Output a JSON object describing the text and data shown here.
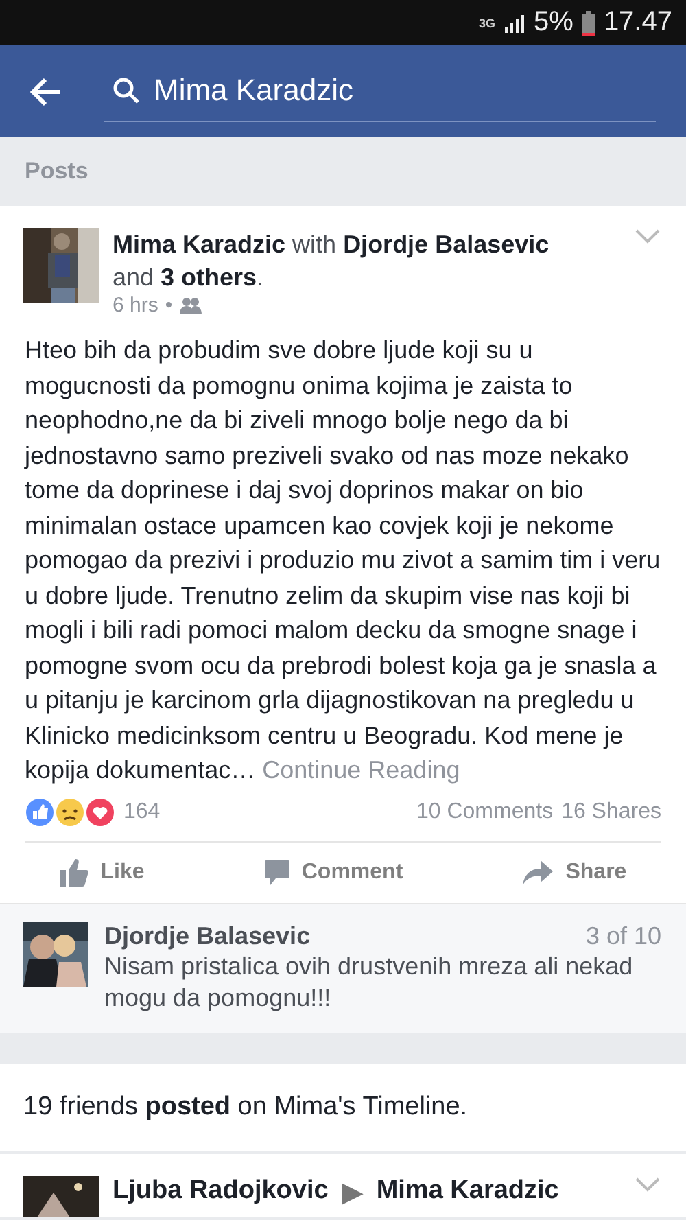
{
  "status_bar": {
    "network": "3G",
    "battery": "5%",
    "time": "17.47"
  },
  "header": {
    "search_value": "Mima Karadzic"
  },
  "section_label": "Posts",
  "post": {
    "title": "**Mima Karadzic** with **Djordje Balasevic** and **3 others**.",
    "time": "6 hrs",
    "separator": "•",
    "body": "Hteo bih da probudim sve dobre ljude koji su u mogucnosti da pomognu onima kojima je zaista to neophodno,ne da bi ziveli mnogo bolje nego da bi jednostavno samo preziveli svako od nas moze nekako tome da doprinese i daj svoj doprinos makar on bio minimalan ostace upamcen kao covjek koji je nekome pomogao da prezivi i produzio mu zivot a samim tim i veru u dobre ljude. Trenutno zelim da skupim vise nas koji bi mogli i bili radi pomoci malom decku da smogne snage i pomogne svom ocu da prebrodi bolest koja ga je snasla a u pitanju je karcinom grla dijagnostikovan na pregledu u Klinicko medicinksom centru u Beogradu. Kod mene je kopija dokumentac…",
    "continue": "Continue Reading",
    "reactions": "164",
    "comments": "10 Comments",
    "shares": "16 Shares",
    "actions": [
      {
        "kind": "like",
        "label": "Like"
      },
      {
        "kind": "comment",
        "label": "Comment"
      },
      {
        "kind": "share",
        "label": "Share"
      }
    ],
    "top_comment": {
      "author": "Djordje Balasevic",
      "position": "3 of 10",
      "text": "Nisam pristalica ovih drustvenih mreza ali nekad mogu da pomognu!!!"
    }
  },
  "friends_posted": "19 friends **posted** on Mima's Timeline.",
  "next_post": {
    "author": "Ljuba Radojkovic",
    "arrow": "▶",
    "target": "Mima Karadzic"
  }
}
